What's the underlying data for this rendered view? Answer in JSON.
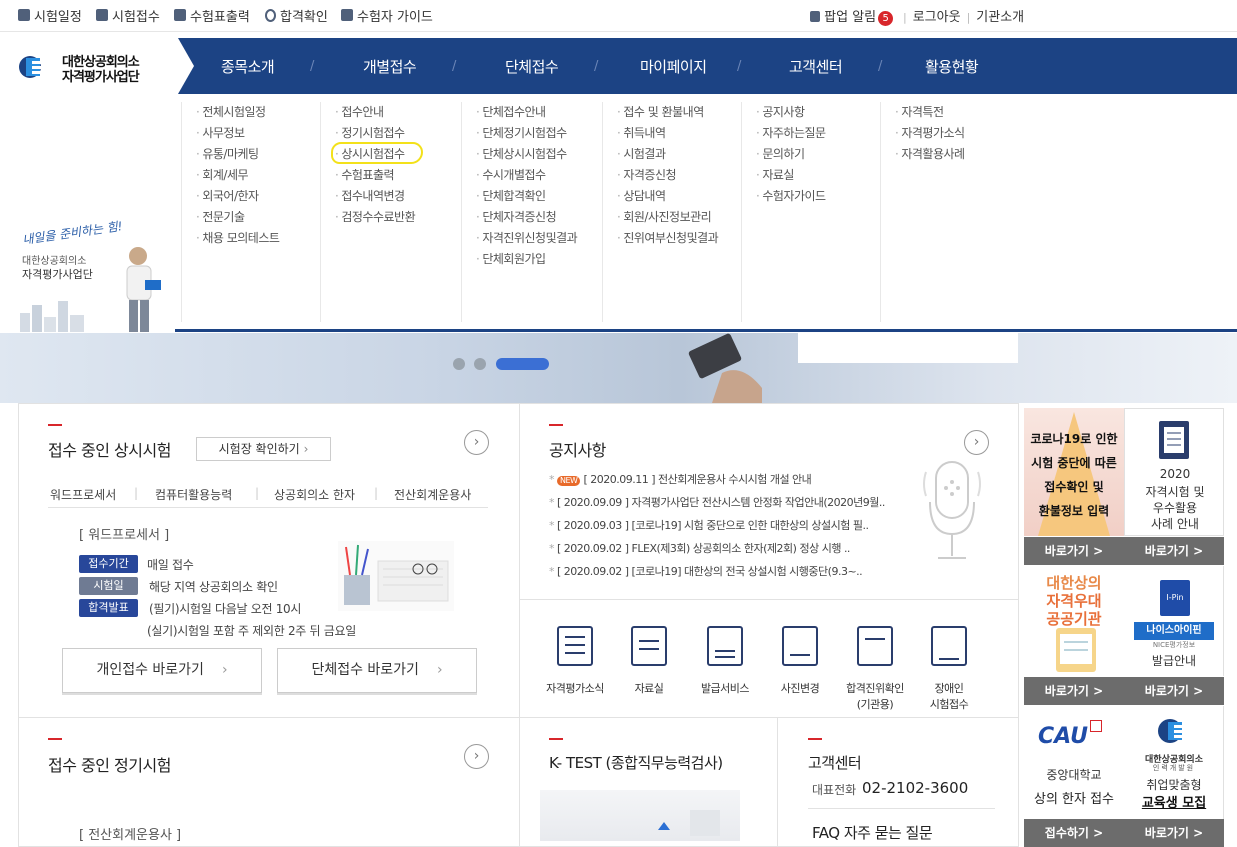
{
  "topbar": {
    "links": [
      "시험일정",
      "시험접수",
      "수험표출력",
      "합격확인",
      "수험자 가이드"
    ],
    "popup_label": "팝업 알림",
    "popup_count": "5",
    "logout": "로그아웃",
    "org_intro": "기관소개"
  },
  "logo": {
    "line1": "대한상공회의소",
    "line2": "자격평가사업단"
  },
  "gnb": [
    "종목소개",
    "개별접수",
    "단체접수",
    "마이페이지",
    "고객센터",
    "활용현황"
  ],
  "mega": {
    "col1": [
      "전체시험일정",
      "사무정보",
      "유통/마케팅",
      "회계/세무",
      "외국어/한자",
      "전문기술",
      "채용 모의테스트"
    ],
    "col2": [
      "접수안내",
      "정기시험접수",
      "상시시험접수",
      "수험표출력",
      "접수내역변경",
      "검정수수료반환"
    ],
    "col3": [
      "단체접수안내",
      "단체정기시험접수",
      "단체상시시험접수",
      "수시개별접수",
      "단체합격확인",
      "단체자격증신청",
      "자격진위신청및결과",
      "단체회원가입"
    ],
    "col4": [
      "접수 및 환불내역",
      "취득내역",
      "시험결과",
      "자격증신청",
      "상담내역",
      "회원/사진정보관리",
      "진위여부신청및결과"
    ],
    "col5": [
      "공지사항",
      "자주하는질문",
      "문의하기",
      "자료실",
      "수험자가이드"
    ],
    "col6": [
      "자격특전",
      "자격평가소식",
      "자격활용사례"
    ]
  },
  "side": {
    "slogan": "내일을 준비하는 힘!",
    "org1": "대한상공회의소",
    "org2": "자격평가사업단"
  },
  "sangsi": {
    "title": "접수 중인 상시시험",
    "hall_btn": "시험장 확인하기",
    "tabs": [
      "워드프로세서",
      "컴퓨터활용능력",
      "상공회의소 한자",
      "전산회계운용사"
    ],
    "exam_name": "[ 워드프로세서 ]",
    "rows": [
      {
        "tag": "접수기간",
        "text": "매일 접수"
      },
      {
        "tag": "시험일",
        "text": "해당 지역 상공회의소 확인"
      },
      {
        "tag": "합격발표",
        "text": "(필기)시험일 다음날 오전 10시"
      }
    ],
    "extra": "(실기)시험일 포함 주 제외한 2주 뒤 금요일",
    "btn_personal": "개인접수 바로가기",
    "btn_group": "단체접수 바로가기"
  },
  "notice": {
    "title": "공지사항",
    "new_badge": "NEW",
    "items": [
      "[ 2020.09.11 ] 전산회계운용사 수시시험 개설 안내",
      "[ 2020.09.09 ] 자격평가사업단 전산시스템 안정화 작업안내(2020년9월..",
      "[ 2020.09.03 ] [코로나19] 시험 중단으로 인한 대한상의 상설시험 필..",
      "[ 2020.09.02 ] FLEX(제3회) 상공회의소 한자(제2회) 정상 시행 ..",
      "[ 2020.09.02 ] [코로나19] 대한상의 전국 상설시험 시행중단(9.3~.."
    ]
  },
  "services": [
    {
      "l1": "자격평가소식",
      "l2": ""
    },
    {
      "l1": "자료실",
      "l2": ""
    },
    {
      "l1": "발급서비스",
      "l2": ""
    },
    {
      "l1": "사진변경",
      "l2": ""
    },
    {
      "l1": "합격진위확인",
      "l2": "(기관용)"
    },
    {
      "l1": "장애인",
      "l2": "시험접수"
    }
  ],
  "jeonggi": {
    "title": "접수 중인 정기시험",
    "exam_name": "[ 전산회계운용사 ]"
  },
  "ktest": {
    "title": "K- TEST (종합직무능력검사)"
  },
  "cs": {
    "title": "고객센터",
    "phone_label": "대표전화",
    "phone": "02-2102-3600",
    "faq": "FAQ 자주 묻는 질문"
  },
  "banners": {
    "covid": [
      "코로나19로 인한",
      "시험 중단에 따른",
      "접수확인 및",
      "환불정보 입력"
    ],
    "guide": [
      "2020",
      "자격시험 및",
      "우수활용",
      "사례 안내"
    ],
    "public1": "대한상의",
    "public2": "자격우대",
    "public3": "공공기관",
    "ipin_logo": "I-Pin",
    "ipin_brand": "나이스아이핀",
    "ipin_sub": "NICE평가정보",
    "ipin_label": "발급안내",
    "cau_logo": "CAU",
    "cau1": "중앙대학교",
    "cau2": "상의 한자 접수",
    "hrd1": "대한상공회의소",
    "hrd2": "인력개발원",
    "hrd3": "취업맞춤형",
    "hrd4": "교육생 모집",
    "go": "바로가기 >",
    "apply": "접수하기 >"
  }
}
